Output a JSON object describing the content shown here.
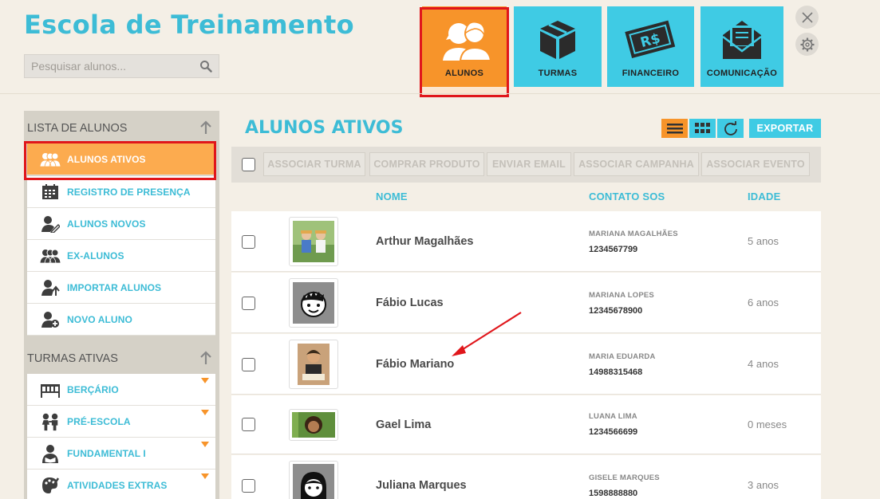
{
  "app": {
    "title": "Escola de Treinamento"
  },
  "search": {
    "placeholder": "Pesquisar alunos..."
  },
  "modules": [
    {
      "label": "ALUNOS",
      "icon": "students-icon",
      "active": true
    },
    {
      "label": "TURMAS",
      "icon": "box-icon",
      "active": false
    },
    {
      "label": "FINANCEIRO",
      "icon": "money-icon",
      "active": false
    },
    {
      "label": "COMUNICAÇÃO",
      "icon": "envelope-icon",
      "active": false
    }
  ],
  "sidebar": {
    "list_header": "LISTA DE ALUNOS",
    "list_items": [
      {
        "label": "ALUNOS ATIVOS",
        "icon": "group-icon",
        "active": true
      },
      {
        "label": "REGISTRO DE PRESENÇA",
        "icon": "calendar-icon"
      },
      {
        "label": "ALUNOS NOVOS",
        "icon": "user-edit-icon"
      },
      {
        "label": "EX-ALUNOS",
        "icon": "group-icon"
      },
      {
        "label": "IMPORTAR ALUNOS",
        "icon": "user-import-icon"
      },
      {
        "label": "NOVO ALUNO",
        "icon": "user-add-icon"
      }
    ],
    "classes_header": "TURMAS ATIVAS",
    "class_items": [
      {
        "label": "BERÇÁRIO",
        "icon": "crib-icon"
      },
      {
        "label": "PRÉ-ESCOLA",
        "icon": "children-icon"
      },
      {
        "label": "FUNDAMENTAL I",
        "icon": "reader-icon"
      },
      {
        "label": "ATIVIDADES EXTRAS",
        "icon": "palette-icon"
      }
    ]
  },
  "main": {
    "title": "ALUNOS ATIVOS",
    "export_label": "EXPORTAR",
    "actions": [
      "ASSOCIAR TURMA",
      "COMPRAR PRODUTO",
      "ENVIAR EMAIL",
      "ASSOCIAR CAMPANHA",
      "ASSOCIAR EVENTO"
    ],
    "columns": {
      "name": "NOME",
      "contact": "CONTATO SOS",
      "age": "IDADE"
    },
    "rows": [
      {
        "name": "Arthur Magalhães",
        "contact_name": "MARIANA MAGALHÃES",
        "contact_phone": "1234567799",
        "age": "5 anos",
        "photo": "photo"
      },
      {
        "name": "Fábio Lucas",
        "contact_name": "MARIANA LOPES",
        "contact_phone": "12345678900",
        "age": "6 anos",
        "photo": "boy-avatar"
      },
      {
        "name": "Fábio Mariano",
        "contact_name": "MARIA EDUARDA",
        "contact_phone": "14988315468",
        "age": "4 anos",
        "photo": "photo"
      },
      {
        "name": "Gael Lima",
        "contact_name": "LUANA LIMA",
        "contact_phone": "1234566699",
        "age": "0 meses",
        "photo": "photo"
      },
      {
        "name": "Juliana Marques",
        "contact_name": "GISELE MARQUES",
        "contact_phone": "1598888880",
        "age": "3 anos",
        "photo": "girl-avatar"
      }
    ]
  },
  "colors": {
    "accent": "#3dbcd6",
    "active": "#f7942a",
    "highlight": "#e0161b"
  }
}
